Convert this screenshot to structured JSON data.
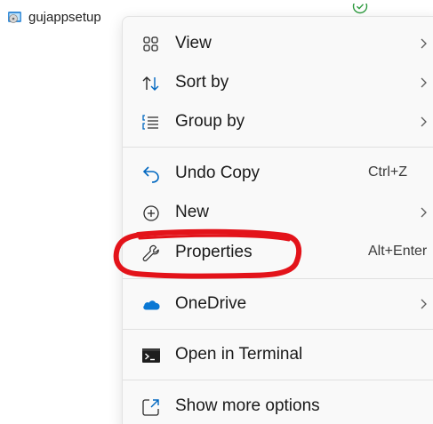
{
  "file": {
    "name": "gujappsetup",
    "icon": "installer-icon",
    "status_icon": "sync-status-icon"
  },
  "menu": {
    "items": [
      {
        "label": "View",
        "icon": "grid-view-icon",
        "has_submenu": true
      },
      {
        "label": "Sort by",
        "icon": "sort-icon",
        "has_submenu": true
      },
      {
        "label": "Group by",
        "icon": "group-list-icon",
        "has_submenu": true
      },
      {
        "label": "Undo Copy",
        "icon": "undo-icon",
        "shortcut": "Ctrl+Z"
      },
      {
        "label": "New",
        "icon": "plus-circle-icon",
        "has_submenu": true
      },
      {
        "label": "Properties",
        "icon": "wrench-icon",
        "shortcut": "Alt+Enter"
      },
      {
        "label": "OneDrive",
        "icon": "onedrive-cloud-icon",
        "has_submenu": true
      },
      {
        "label": "Open in Terminal",
        "icon": "terminal-icon"
      },
      {
        "label": "Show more options",
        "icon": "share-expand-icon"
      }
    ]
  },
  "annotation": {
    "highlight_color": "#e3131a",
    "highlighted_item": "Properties"
  },
  "colors": {
    "menu_bg": "#f9f9f9",
    "accent_blue": "#0067c0",
    "onedrive_blue": "#0a78d4"
  }
}
